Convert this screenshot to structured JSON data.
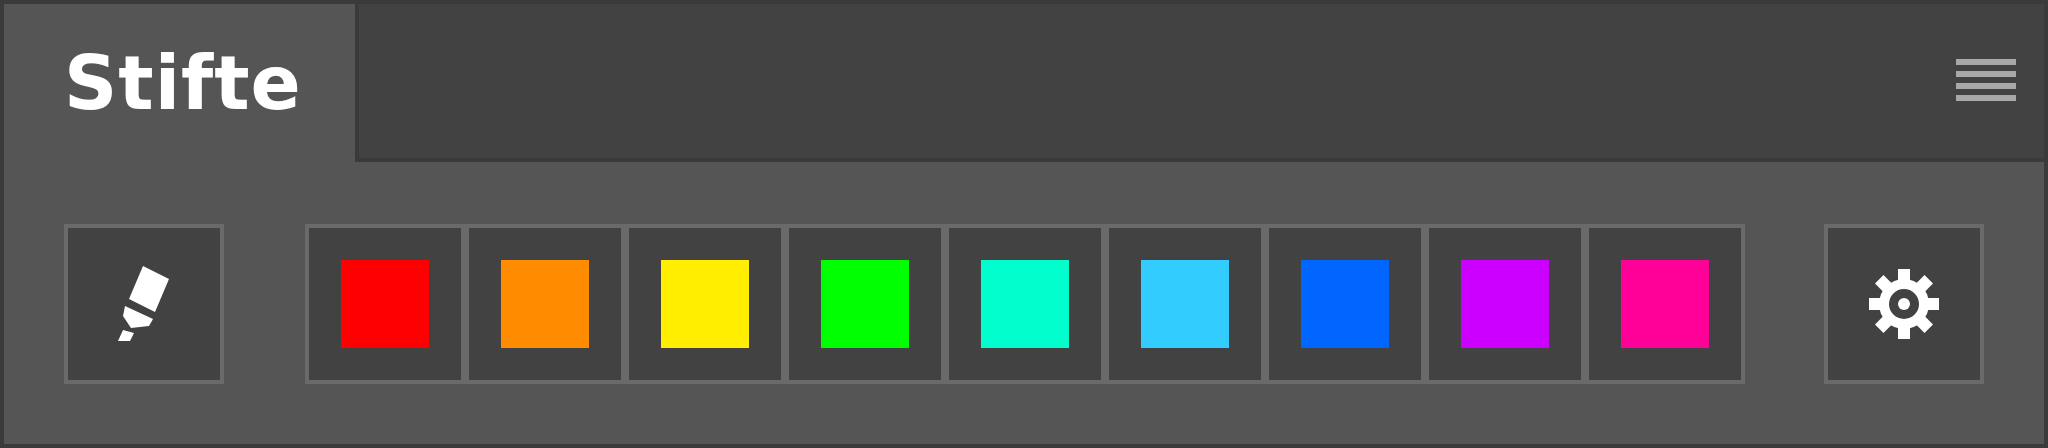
{
  "tab": {
    "title": "Stifte"
  },
  "swatches": [
    {
      "color": "#ff0000"
    },
    {
      "color": "#ff8c00"
    },
    {
      "color": "#ffee00"
    },
    {
      "color": "#00ff00"
    },
    {
      "color": "#00ffcc"
    },
    {
      "color": "#33ccff"
    },
    {
      "color": "#0066ff"
    },
    {
      "color": "#cc00ff"
    },
    {
      "color": "#ff0099"
    }
  ]
}
